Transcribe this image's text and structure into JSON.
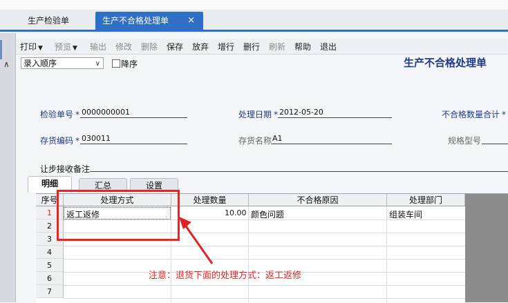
{
  "tabs": [
    {
      "label": "生产检验单"
    },
    {
      "label": "生产不合格处理单",
      "close": "×"
    }
  ],
  "toolbar": {
    "print": "打印",
    "preview": "预览",
    "output": "输出",
    "edit": "修改",
    "delete": "删除",
    "save": "保存",
    "discard": "放弃",
    "add_row": "增行",
    "del_row": "删行",
    "refresh": "刷新",
    "help": "帮助",
    "exit": "退出"
  },
  "sort": {
    "value": "录入顺序",
    "desc_label": "降序"
  },
  "form": {
    "title": "生产不合格处理单",
    "inspection_no_label": "检验单号",
    "inspection_no": "0000000001",
    "process_date_label": "处理日期",
    "process_date": "2012-05-20",
    "unqualified_total_label": "不合格数量合计",
    "inventory_code_label": "存货编码",
    "inventory_code": "030011",
    "inventory_name_label": "存货名称",
    "inventory_name": "A1",
    "spec_label": "规格型号",
    "remark_label": "让步接收备注",
    "required_mark": "*"
  },
  "subtabs": [
    "明细",
    "汇总",
    "设置"
  ],
  "grid": {
    "headers": [
      "序号",
      "处理方式",
      "处理数量",
      "不合格原因",
      "处理部门"
    ],
    "rows": [
      {
        "no": "1",
        "method": "返工返修",
        "qty": "10.00",
        "reason": "颜色问题",
        "dept": "组装车间"
      },
      {
        "no": "2"
      },
      {
        "no": "3"
      },
      {
        "no": "4"
      },
      {
        "no": "5"
      },
      {
        "no": "6"
      },
      {
        "no": "7"
      }
    ]
  },
  "annotation": {
    "note": "注意：退货下面的处理方式：返工返修",
    "color": "#e22222"
  },
  "colors": {
    "accent": "#2f6fc6",
    "label": "#1f3a8a"
  }
}
